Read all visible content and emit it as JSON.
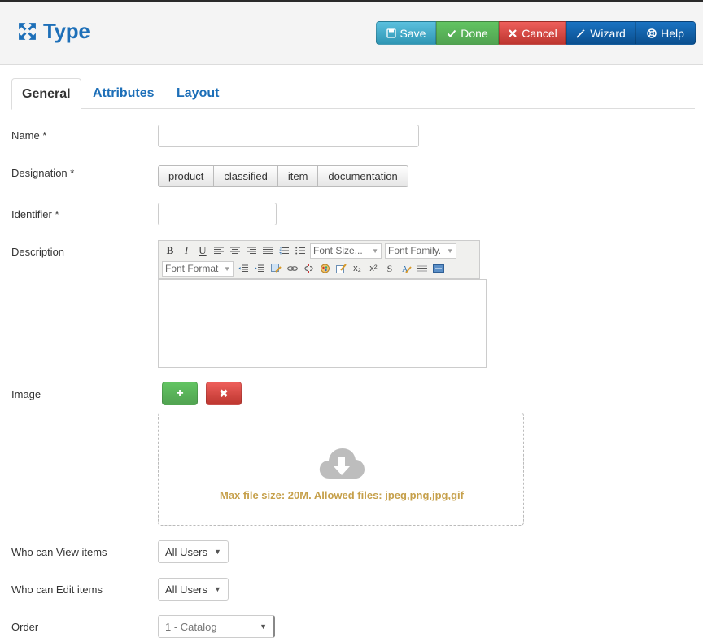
{
  "header": {
    "title": "Type",
    "buttons": {
      "save": "Save",
      "done": "Done",
      "cancel": "Cancel",
      "wizard": "Wizard",
      "help": "Help"
    }
  },
  "tabs": [
    "General",
    "Attributes",
    "Layout"
  ],
  "form": {
    "name_label": "Name *",
    "name_value": "",
    "designation_label": "Designation *",
    "designation_options": [
      "product",
      "classified",
      "item",
      "documentation"
    ],
    "identifier_label": "Identifier *",
    "identifier_value": "",
    "description_label": "Description",
    "image_label": "Image",
    "image_add": "+",
    "image_remove": "✖",
    "dropzone_text": "Max file size: 20M. Allowed files: jpeg,png,jpg,gif",
    "view_label": "Who can View items",
    "view_value": "All Users",
    "edit_label": "Who can Edit items",
    "edit_value": "All Users",
    "order_label": "Order",
    "order_value": "1 - Catalog"
  },
  "editor": {
    "font_size": "Font Size...",
    "font_family": "Font Family.",
    "font_format": "Font Format",
    "bold": "B",
    "italic": "I",
    "underline": "U",
    "subscript": "x₂",
    "superscript": "x²",
    "strike": "S"
  },
  "colors": {
    "accent": "#1d6fb8",
    "info": "#2f96b4",
    "success": "#51a351",
    "danger": "#bd362f",
    "primary": "#0b4f8f",
    "warning_text": "#c6a04b"
  }
}
